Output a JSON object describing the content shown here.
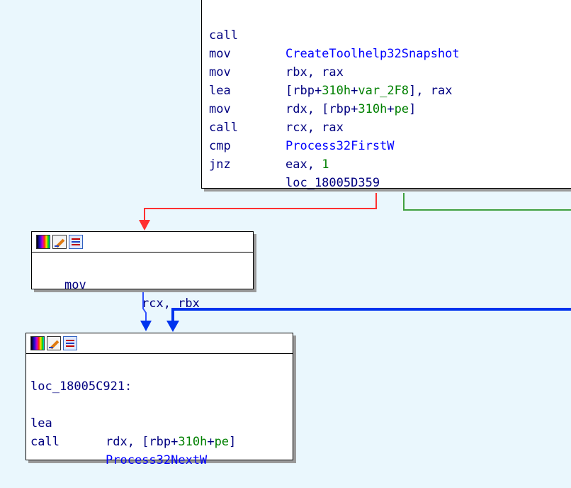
{
  "colors": {
    "background": "#eaf7fd",
    "edge_false": "#ff3030",
    "edge_true": "#40a040",
    "edge_jump": "#0033ee",
    "function_name": "#0000ff",
    "number": "#008000",
    "register": "#000080"
  },
  "icons": [
    "color-palette-icon",
    "edit-pencil-icon",
    "graph-overview-icon"
  ],
  "blocks": {
    "top": {
      "lines": [
        {
          "mnemonic": "call",
          "op": "CreateToolhelp32Snapshot"
        },
        {
          "mnemonic": "mov",
          "op_a": "rbx, rax"
        },
        {
          "mnemonic": "mov",
          "op_a": "[rbp+",
          "op_num1": "310h",
          "op_b": "+",
          "op_num2": "var_2F8",
          "op_c": "], rax"
        },
        {
          "mnemonic": "lea",
          "op_a": "rdx, [rbp+",
          "op_num1": "310h",
          "op_b": "+",
          "op_num2": "pe",
          "op_c": "]"
        },
        {
          "mnemonic": "mov",
          "op_a": "rcx, rax"
        },
        {
          "mnemonic": "call",
          "op": "Process32FirstW"
        },
        {
          "mnemonic": "cmp",
          "op_a": "eax, ",
          "op_num1": "1"
        },
        {
          "mnemonic": "jnz",
          "op_a": "loc_18005D359"
        }
      ]
    },
    "middle": {
      "lines": [
        {
          "mnemonic": "mov",
          "op_a": "rcx, rbx"
        }
      ]
    },
    "bottom": {
      "label": "loc_18005C921:",
      "lines": [
        {
          "mnemonic": "lea",
          "op_a": "rdx, [rbp+",
          "op_num1": "310h",
          "op_b": "+",
          "op_num2": "pe",
          "op_c": "]"
        },
        {
          "mnemonic": "call",
          "op": "Process32NextW"
        }
      ]
    }
  }
}
